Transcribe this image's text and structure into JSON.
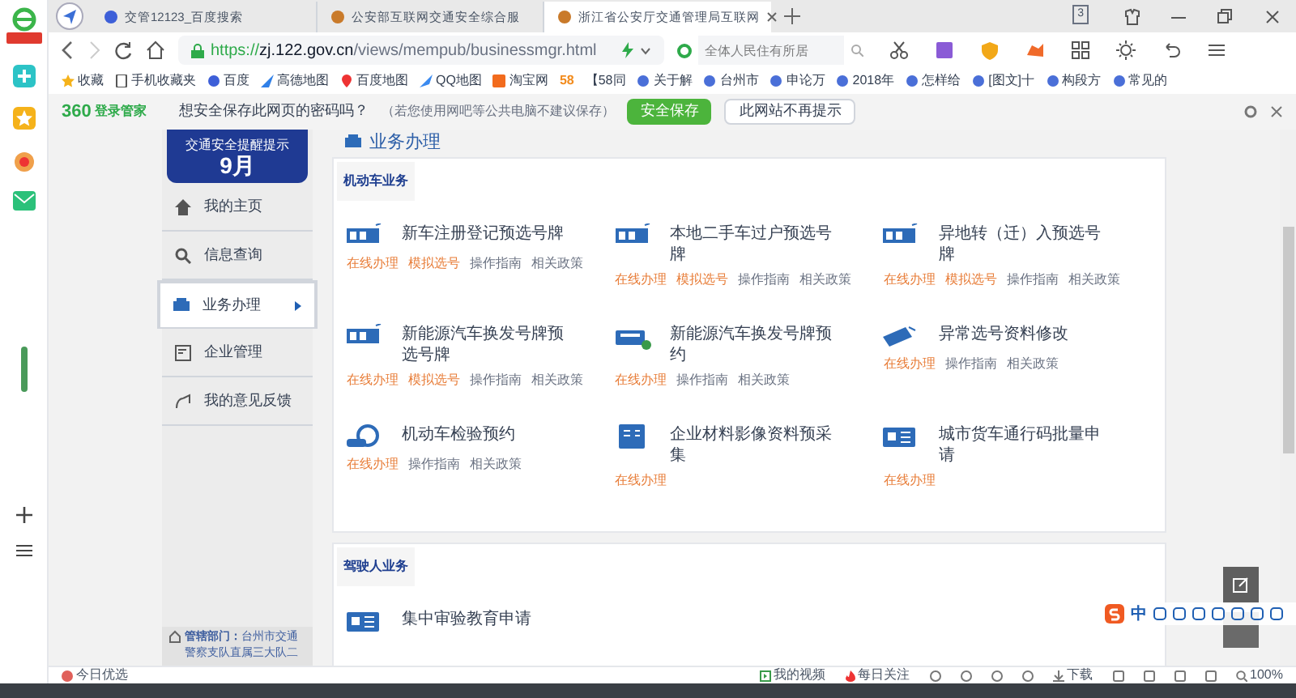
{
  "tabs": [
    {
      "title": "交管12123_百度搜索",
      "selected": false
    },
    {
      "title": "公安部互联网交通安全综合服",
      "selected": false
    },
    {
      "title": "浙江省公安厅交通管理局互联网",
      "selected": true
    }
  ],
  "tab_count": "3",
  "address": {
    "scheme": "https://",
    "host": "zj.122.gov.cn",
    "path": "/views/mempub/businessmgr.html"
  },
  "search": {
    "placeholder": "全体人民住有所居"
  },
  "bookmarks": [
    "收藏",
    "手机收藏夹",
    "百度",
    "高德地图",
    "百度地图",
    "QQ地图",
    "淘宝网",
    "58",
    "【58同",
    "关于解",
    "台州市",
    "申论万",
    "2018年",
    "怎样给",
    "[图文]十",
    "构段方",
    "常见的"
  ],
  "password_bar": {
    "logo": "360",
    "brand": "登录管家",
    "question": "想安全保存此网页的密码吗？",
    "note": "（若您使用网吧等公共电脑不建议保存）",
    "buttons": [
      "安全保存",
      "此网站不再提示"
    ]
  },
  "sidebar": {
    "banner_title": "交通安全提醒提示",
    "banner_month": "9月",
    "items": [
      {
        "label": "我的主页",
        "selected": false
      },
      {
        "label": "信息查询",
        "selected": false
      },
      {
        "label": "业务办理",
        "selected": true
      },
      {
        "label": "企业管理",
        "selected": false
      },
      {
        "label": "我的意见反馈",
        "selected": false
      }
    ],
    "footer_label": "管辖部门：",
    "footer_text": "台州市交通警察支队直属三大队二"
  },
  "page_title": "业务办理",
  "sections": [
    {
      "title": "机动车业务",
      "items": [
        {
          "title": "新车注册登记预选号牌",
          "links": [
            {
              "text": "在线办理",
              "kind": "primary"
            },
            {
              "text": "模拟选号",
              "kind": "primary"
            },
            {
              "text": "操作指南",
              "kind": "normal"
            },
            {
              "text": "相关政策",
              "kind": "normal"
            }
          ]
        },
        {
          "title": "本地二手车过户预选号牌",
          "links": [
            {
              "text": "在线办理",
              "kind": "primary"
            },
            {
              "text": "模拟选号",
              "kind": "primary"
            },
            {
              "text": "操作指南",
              "kind": "normal"
            },
            {
              "text": "相关政策",
              "kind": "normal"
            }
          ]
        },
        {
          "title": "异地转（迁）入预选号牌",
          "links": [
            {
              "text": "在线办理",
              "kind": "primary"
            },
            {
              "text": "模拟选号",
              "kind": "primary"
            },
            {
              "text": "操作指南",
              "kind": "normal"
            },
            {
              "text": "相关政策",
              "kind": "normal"
            }
          ]
        },
        {
          "title": "新能源汽车换发号牌预选号牌",
          "links": [
            {
              "text": "在线办理",
              "kind": "primary"
            },
            {
              "text": "模拟选号",
              "kind": "primary"
            },
            {
              "text": "操作指南",
              "kind": "normal"
            },
            {
              "text": "相关政策",
              "kind": "normal"
            }
          ]
        },
        {
          "title": "新能源汽车换发号牌预约",
          "links": [
            {
              "text": "在线办理",
              "kind": "primary"
            },
            {
              "text": "操作指南",
              "kind": "normal"
            },
            {
              "text": "相关政策",
              "kind": "normal"
            }
          ]
        },
        {
          "title": "异常选号资料修改",
          "links": [
            {
              "text": "在线办理",
              "kind": "primary"
            },
            {
              "text": "操作指南",
              "kind": "normal"
            },
            {
              "text": "相关政策",
              "kind": "normal"
            }
          ]
        },
        {
          "title": "机动车检验预约",
          "links": [
            {
              "text": "在线办理",
              "kind": "primary"
            },
            {
              "text": "操作指南",
              "kind": "normal"
            },
            {
              "text": "相关政策",
              "kind": "normal"
            }
          ]
        },
        {
          "title": "企业材料影像资料预采集",
          "links": [
            {
              "text": "在线办理",
              "kind": "primary"
            }
          ]
        },
        {
          "title": "城市货车通行码批量申请",
          "links": [
            {
              "text": "在线办理",
              "kind": "primary"
            }
          ]
        }
      ]
    },
    {
      "title": "驾驶人业务",
      "items": [
        {
          "title": "集中审验教育申请"
        }
      ]
    }
  ],
  "ime": {
    "mode": "中"
  },
  "status_bar": {
    "left": "今日优选",
    "video": "我的视频",
    "daily": "每日关注",
    "download": "下载",
    "zoom": "100%"
  }
}
